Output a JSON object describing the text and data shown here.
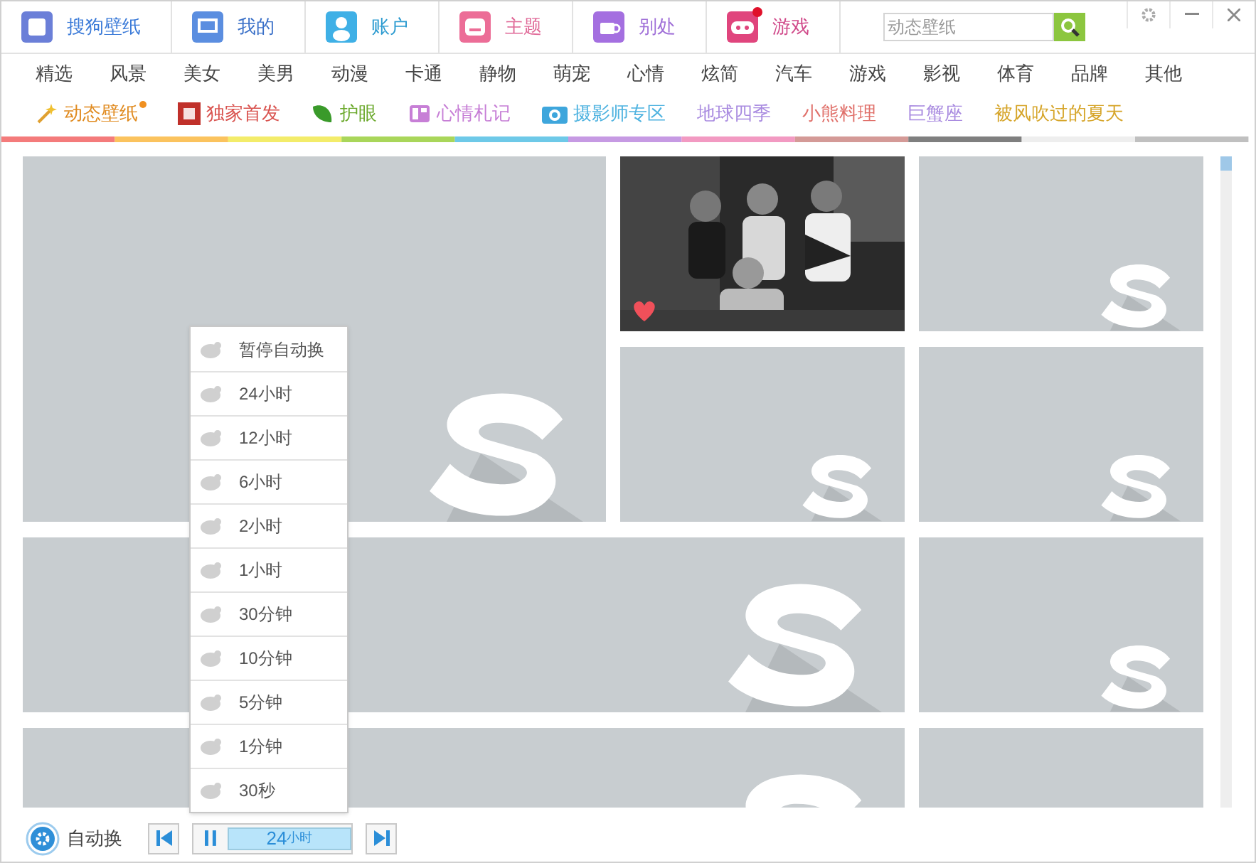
{
  "top_tabs": [
    {
      "label": "搜狗壁纸",
      "kind": "logo"
    },
    {
      "label": "我的",
      "kind": "monitor"
    },
    {
      "label": "账户",
      "kind": "user"
    },
    {
      "label": "主题",
      "kind": "theme"
    },
    {
      "label": "别处",
      "kind": "cup"
    },
    {
      "label": "游戏",
      "kind": "gamepad",
      "badge": true
    }
  ],
  "search": {
    "placeholder": "动态壁纸"
  },
  "categories": [
    "精选",
    "风景",
    "美女",
    "美男",
    "动漫",
    "卡通",
    "静物",
    "萌宠",
    "心情",
    "炫简",
    "汽车",
    "游戏",
    "影视",
    "体育",
    "品牌",
    "其他"
  ],
  "specials": [
    {
      "label": "动态壁纸",
      "kind": "wand",
      "color": "#e08a1e",
      "dot": true
    },
    {
      "label": "独家首发",
      "kind": "exclusive",
      "color": "#d9534f"
    },
    {
      "label": "护眼",
      "kind": "leaf",
      "color": "#6aa82a"
    },
    {
      "label": "心情札记",
      "kind": "notebook",
      "color": "#c77fd6"
    },
    {
      "label": "摄影师专区",
      "kind": "camera",
      "color": "#4fb3e0"
    },
    {
      "label": "地球四季",
      "color": "#a98be0"
    },
    {
      "label": "小熊料理",
      "color": "#e0706a"
    },
    {
      "label": "巨蟹座",
      "color": "#a98be0"
    },
    {
      "label": "被风吹过的夏天",
      "color": "#d6a52a"
    }
  ],
  "tiles": [
    {
      "kind": "large"
    },
    {
      "kind": "picture",
      "liked": true
    },
    {
      "kind": "placeholder"
    },
    {
      "kind": "placeholder"
    },
    {
      "kind": "placeholder"
    },
    {
      "kind": "wide"
    },
    {
      "kind": "placeholder"
    },
    {
      "kind": "wide"
    },
    {
      "kind": "placeholder"
    }
  ],
  "interval_menu": [
    "暂停自动换",
    "24小时",
    "12小时",
    "6小时",
    "2小时",
    "1小时",
    "30分钟",
    "10分钟",
    "5分钟",
    "1分钟",
    "30秒"
  ],
  "bottom_bar": {
    "auto_label": "自动换",
    "display_value": "24",
    "display_unit": "小时"
  }
}
